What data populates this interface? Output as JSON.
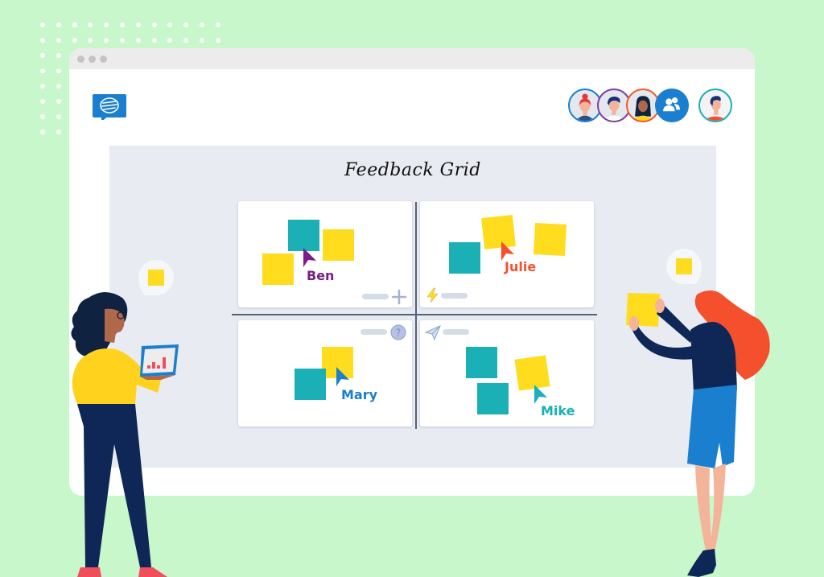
{
  "app": {
    "logo_icon": "chat-bubble-logo-icon",
    "brand_color": "#1b7fcf"
  },
  "window": {
    "traffic_lights": [
      "dot",
      "dot",
      "dot"
    ]
  },
  "collaborators": {
    "group_avatars": [
      {
        "name": "woman-red-hair-avatar",
        "ring_color": "#1b7fcf"
      },
      {
        "name": "man-avatar",
        "ring_color": "#7b3fa6"
      },
      {
        "name": "woman-dark-hair-avatar",
        "ring_color": "#f05a28"
      }
    ],
    "participants_icon": "users-icon",
    "current_user_avatar": {
      "name": "current-user-avatar",
      "ring_color": "#1ab0b6"
    }
  },
  "board": {
    "title": "Feedback Grid",
    "quadrants": [
      {
        "id": "top-left",
        "cursor_user": "Ben",
        "cursor_color": "#7b1d88",
        "toolbar_icon": "plus-icon"
      },
      {
        "id": "top-right",
        "cursor_user": "Julie",
        "cursor_color": "#f4502d",
        "toolbar_icon": "lightning-icon"
      },
      {
        "id": "bottom-left",
        "cursor_user": "Mary",
        "cursor_color": "#1b7fcf",
        "toolbar_icon": "question-icon"
      },
      {
        "id": "bottom-right",
        "cursor_user": "Mike",
        "cursor_color": "#1ab0b6",
        "toolbar_icon": "paper-plane-icon"
      }
    ],
    "note_colors": {
      "yellow": "#ffdc1e",
      "teal": "#1ab0b6"
    }
  },
  "people": [
    {
      "name": "woman-with-laptop",
      "speech": "sticky-note"
    },
    {
      "name": "woman-placing-note",
      "speech": "sticky-note"
    }
  ]
}
